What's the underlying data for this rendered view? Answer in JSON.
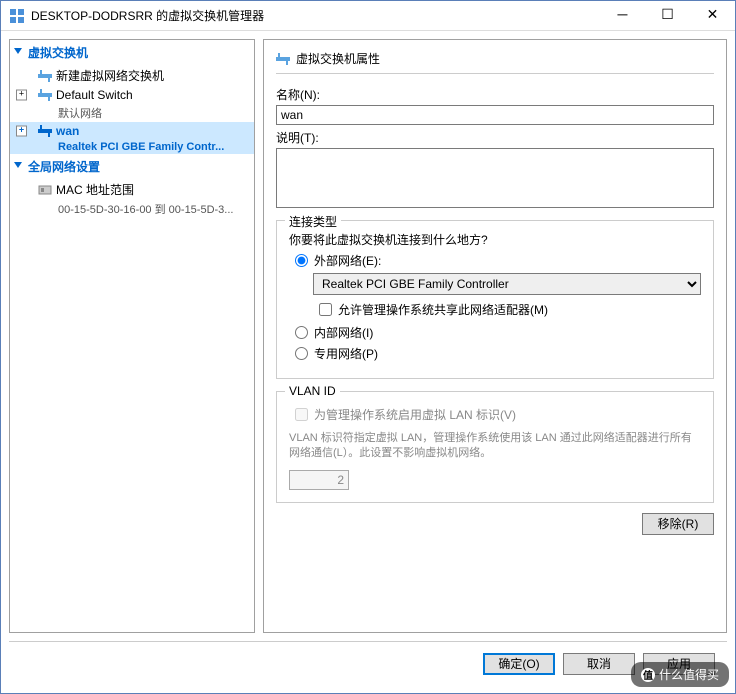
{
  "window": {
    "title": "DESKTOP-DODRSRR 的虚拟交换机管理器"
  },
  "tree": {
    "section_switches": "虚拟交换机",
    "new_switch": "新建虚拟网络交换机",
    "default_switch": "Default Switch",
    "default_switch_sub": "默认网络",
    "wan": "wan",
    "wan_sub": "Realtek PCI GBE Family Contr...",
    "section_global": "全局网络设置",
    "mac_range": "MAC 地址范围",
    "mac_range_sub": "00-15-5D-30-16-00 到 00-15-5D-3..."
  },
  "props": {
    "header": "虚拟交换机属性",
    "name_label": "名称(N):",
    "name_value": "wan",
    "desc_label": "说明(T):",
    "desc_value": ""
  },
  "conn": {
    "group_title": "连接类型",
    "question": "你要将此虚拟交换机连接到什么地方?",
    "external": "外部网络(E):",
    "adapter": "Realtek PCI GBE Family Controller",
    "allow_mgmt": "允许管理操作系统共享此网络适配器(M)",
    "internal": "内部网络(I)",
    "private": "专用网络(P)"
  },
  "vlan": {
    "group_title": "VLAN ID",
    "enable": "为管理操作系统启用虚拟 LAN 标识(V)",
    "help": "VLAN 标识符指定虚拟 LAN，管理操作系统使用该 LAN 通过此网络适配器进行所有网络通信(L）。此设置不影响虚拟机网络。",
    "value": "2"
  },
  "buttons": {
    "remove": "移除(R)",
    "ok": "确定(O)",
    "cancel": "取消",
    "apply": "应用"
  },
  "watermark": "什么值得买"
}
